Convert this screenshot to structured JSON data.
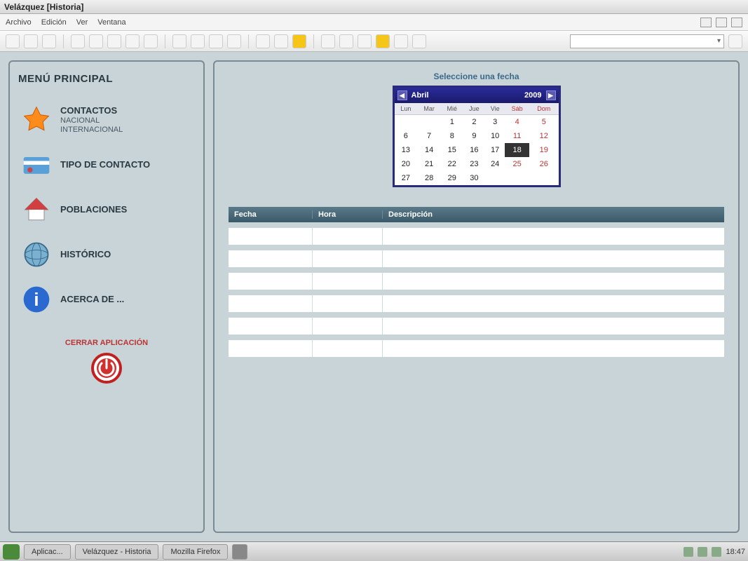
{
  "window": {
    "title": "Velázquez [Historia]"
  },
  "menubar": {
    "items": [
      "Archivo",
      "Edición",
      "Ver",
      "Ventana"
    ]
  },
  "sidebar": {
    "title": "MENÚ PRINCIPAL",
    "items": [
      {
        "label": "CONTACTOS",
        "sub1": "NACIONAL",
        "sub2": "INTERNACIONAL",
        "icon": "star"
      },
      {
        "label": "TIPO DE CONTACTO",
        "icon": "card"
      },
      {
        "label": "POBLACIONES",
        "icon": "house"
      },
      {
        "label": "HISTÓRICO",
        "icon": "globe"
      },
      {
        "label": "ACERCA DE ...",
        "icon": "info"
      }
    ],
    "close_label": "CERRAR APLICACIÓN"
  },
  "main": {
    "select_label": "Seleccione una fecha",
    "calendar": {
      "month": "Abril",
      "year": "2009",
      "day_headers": [
        "Lun",
        "Mar",
        "Mié",
        "Jue",
        "Vie",
        "Sáb",
        "Dom"
      ],
      "weeks": [
        [
          "",
          "",
          "1",
          "2",
          "3",
          "4",
          "5"
        ],
        [
          "6",
          "7",
          "8",
          "9",
          "10",
          "11",
          "12"
        ],
        [
          "13",
          "14",
          "15",
          "16",
          "17",
          "18",
          "19"
        ],
        [
          "20",
          "21",
          "22",
          "23",
          "24",
          "25",
          "26"
        ],
        [
          "27",
          "28",
          "29",
          "30",
          "",
          "",
          ""
        ]
      ],
      "selected": "18"
    },
    "table": {
      "columns": [
        "Fecha",
        "Hora",
        "Descripción"
      ],
      "rows": 6
    }
  },
  "taskbar": {
    "items": [
      "Aplicac...",
      "Velázquez - Historia",
      "Mozilla Firefox"
    ],
    "clock": "18:47"
  },
  "colors": {
    "panel_border": "#7a8a92",
    "cal_border": "#2a2a7a",
    "table_header": "#4a6a7a"
  }
}
